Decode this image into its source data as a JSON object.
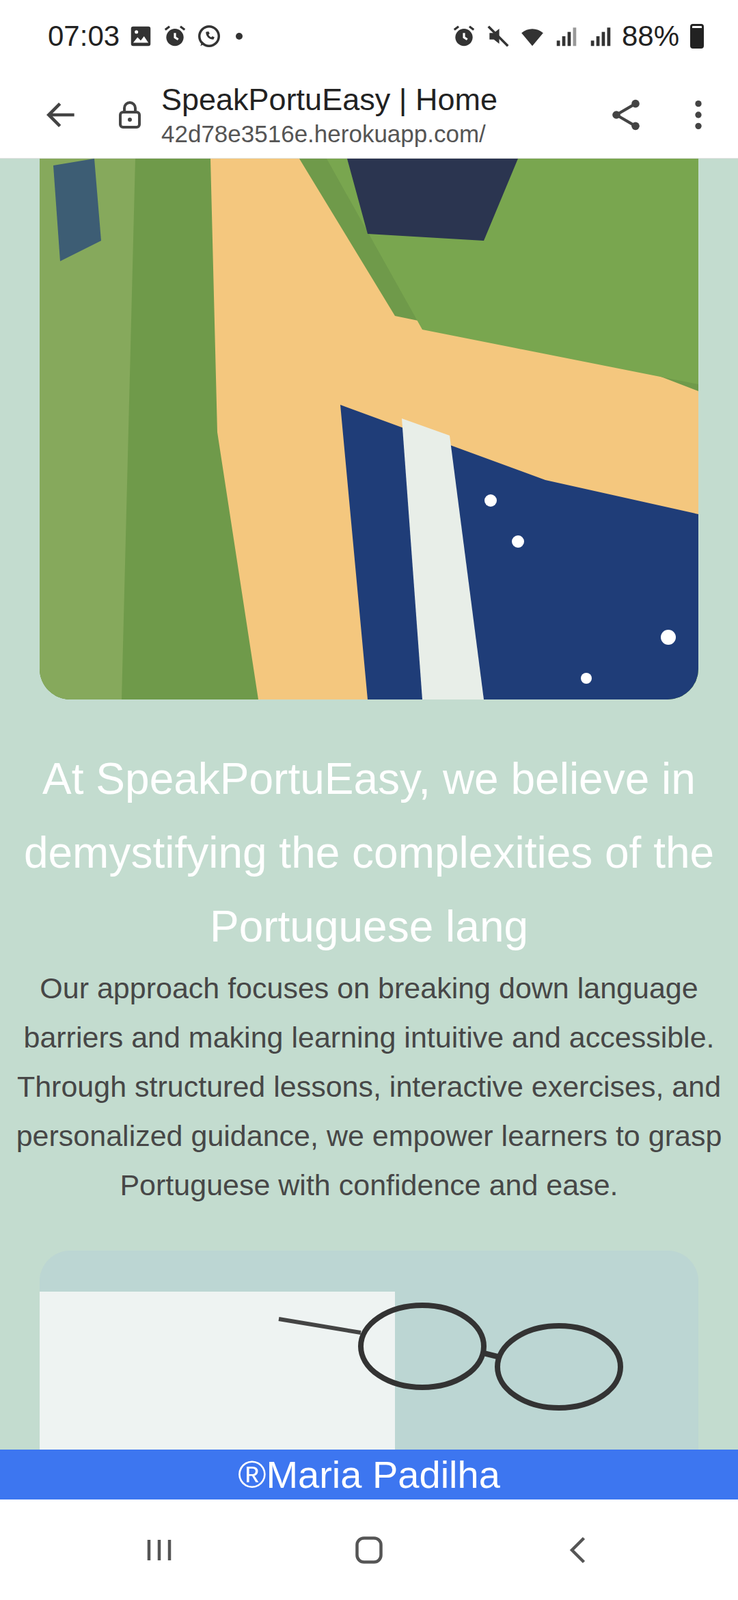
{
  "status_bar": {
    "time": "07:03",
    "battery": "88%",
    "battery_level": 0.88
  },
  "browser": {
    "title": "SpeakPortuEasy | Home",
    "url": "42d78e3516e.herokuapp.com/"
  },
  "page": {
    "heading": "At SpeakPortuEasy, we believe in demystifying the complexities of the Portuguese lang",
    "paragraph": "Our approach focuses on breaking down language barriers and making learning intuitive and accessible. Through structured lessons, interactive exercises, and personalized guidance, we empower learners to grasp Portuguese with confidence and ease.",
    "footer": "®Maria Padilha"
  }
}
